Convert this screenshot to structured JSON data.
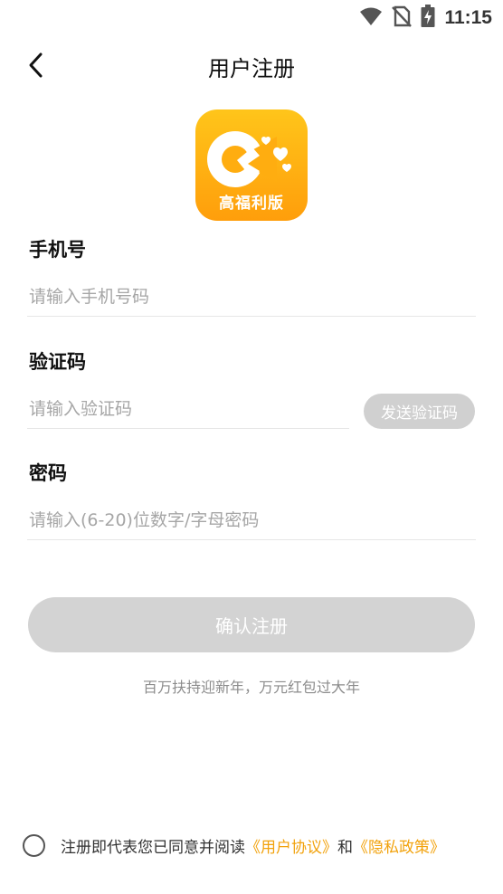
{
  "status_bar": {
    "time": "11:15",
    "icons": [
      "wifi-icon",
      "no-sim-icon",
      "battery-charging-icon"
    ]
  },
  "header": {
    "title": "用户注册",
    "back_icon": "chevron-left-icon"
  },
  "logo": {
    "caption": "高福利版",
    "colors": {
      "top": "#ffc51a",
      "bottom": "#ff9e0b"
    }
  },
  "form": {
    "phone": {
      "label": "手机号",
      "placeholder": "请输入手机号码",
      "value": ""
    },
    "code": {
      "label": "验证码",
      "placeholder": "请输入验证码",
      "value": "",
      "send_button": "发送验证码"
    },
    "password": {
      "label": "密码",
      "placeholder": "请输入(6-20)位数字/字母密码",
      "value": ""
    },
    "submit_label": "确认注册"
  },
  "promo_text": "百万扶持迎新年，万元红包过大年",
  "agreement": {
    "prefix": "注册即代表您已同意并阅读",
    "user_agreement": "《用户协议》",
    "connector": "和",
    "privacy_policy": "《隐私政策》",
    "checked": false,
    "link_color": "#f2a20c"
  }
}
